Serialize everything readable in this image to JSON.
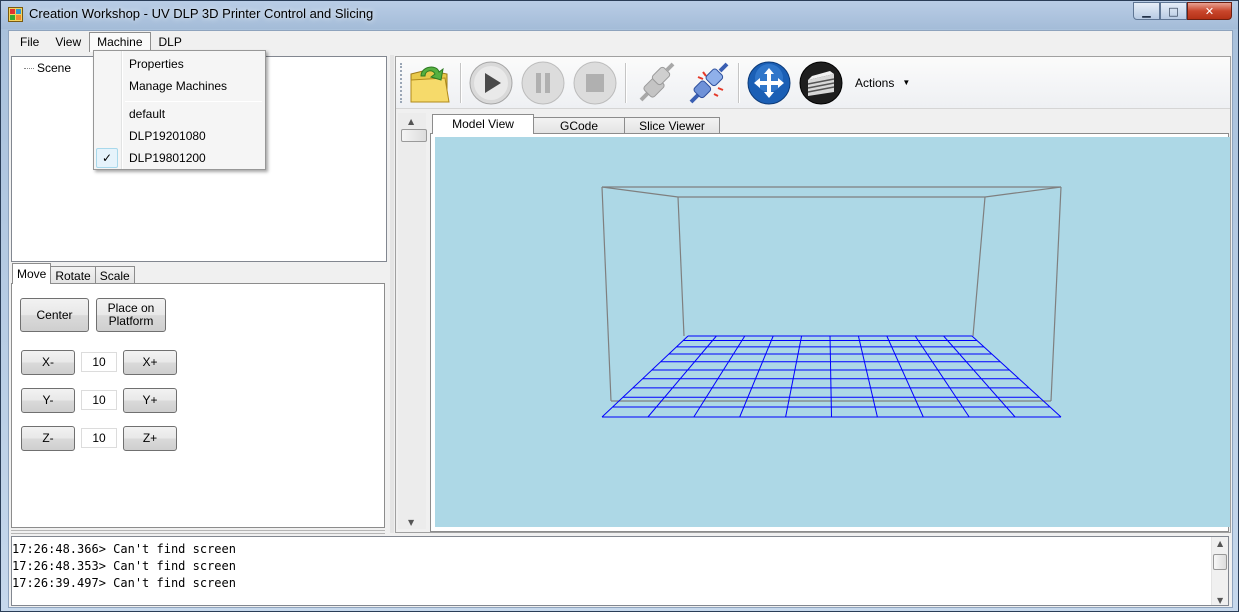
{
  "window": {
    "title": "Creation Workshop - UV DLP 3D Printer Control and Slicing",
    "minimize_glyph": "▁",
    "maximize_glyph": "□",
    "close_glyph": "✕"
  },
  "menubar": {
    "items": [
      "File",
      "View",
      "Machine",
      "DLP"
    ],
    "open_index": 2
  },
  "machine_menu": {
    "items": [
      "Properties",
      "Manage Machines"
    ],
    "machines": [
      "default",
      "DLP19201080",
      "DLP19801200"
    ],
    "checked_machine": "DLP19801200",
    "check_glyph": "✓"
  },
  "scene_tree": {
    "root": "Scene"
  },
  "transform_tabs": {
    "tabs": [
      "Move",
      "Rotate",
      "Scale"
    ],
    "active": "Move"
  },
  "move_panel": {
    "center_label": "Center",
    "place_on_platform_label": "Place on\nPlatform",
    "x_minus": "X-",
    "x_plus": "X+",
    "x_value": "10",
    "y_minus": "Y-",
    "y_plus": "Y+",
    "y_value": "10",
    "z_minus": "Z-",
    "z_plus": "Z+",
    "z_value": "10"
  },
  "toolbar": {
    "buttons": [
      "open-file",
      "play",
      "pause",
      "stop",
      "disconnect",
      "connect",
      "move-view",
      "slice"
    ],
    "actions_label": "Actions",
    "actions_caret": "▼"
  },
  "view_tabs": {
    "tabs": [
      "Model View",
      "GCode",
      "Slice Viewer"
    ],
    "active": "Model View"
  },
  "viewport": {
    "background": "#add8e6",
    "frame_color": "#7f7f7f",
    "grid_color": "#0000ff"
  },
  "log": {
    "lines": [
      "17:26:48.366> Can't find screen",
      "17:26:48.353> Can't find screen",
      "17:26:39.497> Can't find screen"
    ]
  },
  "scroll": {
    "up_glyph": "▲",
    "down_glyph": "▼"
  }
}
